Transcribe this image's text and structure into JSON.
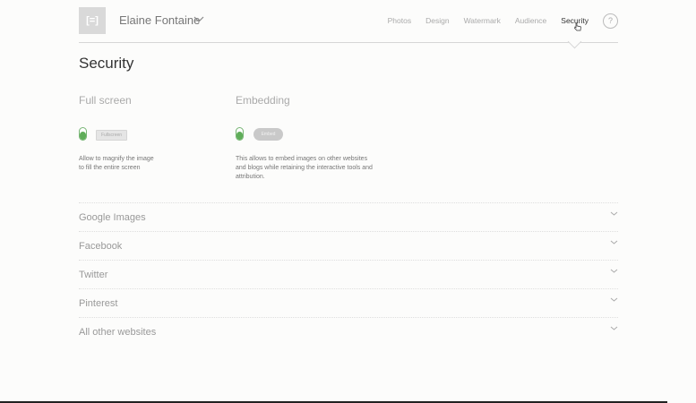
{
  "header": {
    "logo_text": "[=]",
    "user_name": "Elaine Fontaine",
    "nav": [
      "Photos",
      "Design",
      "Watermark",
      "Audience",
      "Security"
    ],
    "active_nav": "Security",
    "help_label": "?"
  },
  "page": {
    "title": "Security"
  },
  "fullscreen": {
    "heading": "Full screen",
    "tag": "Fullscreen",
    "desc_line1": "Allow to magnify the image",
    "desc_line2": "to fill the entire screen",
    "enabled": true
  },
  "embedding": {
    "heading": "Embedding",
    "tag": "Embed",
    "desc_line1": "This allows to embed images on other websites",
    "desc_line2": "and blogs while retaining the interactive tools and",
    "desc_line3": "attribution.",
    "enabled": true
  },
  "sections": [
    "Google Images",
    "Facebook",
    "Twitter",
    "Pinterest",
    "All other websites"
  ],
  "colors": {
    "toggle_on": "#5fad59",
    "bottom_bar": "#222222"
  },
  "icons": {
    "logo": "logo-icon",
    "user_menu": "chevron-down-icon",
    "help": "help-icon",
    "cursor": "hand-cursor-icon",
    "accordion": "chevron-down-icon"
  }
}
